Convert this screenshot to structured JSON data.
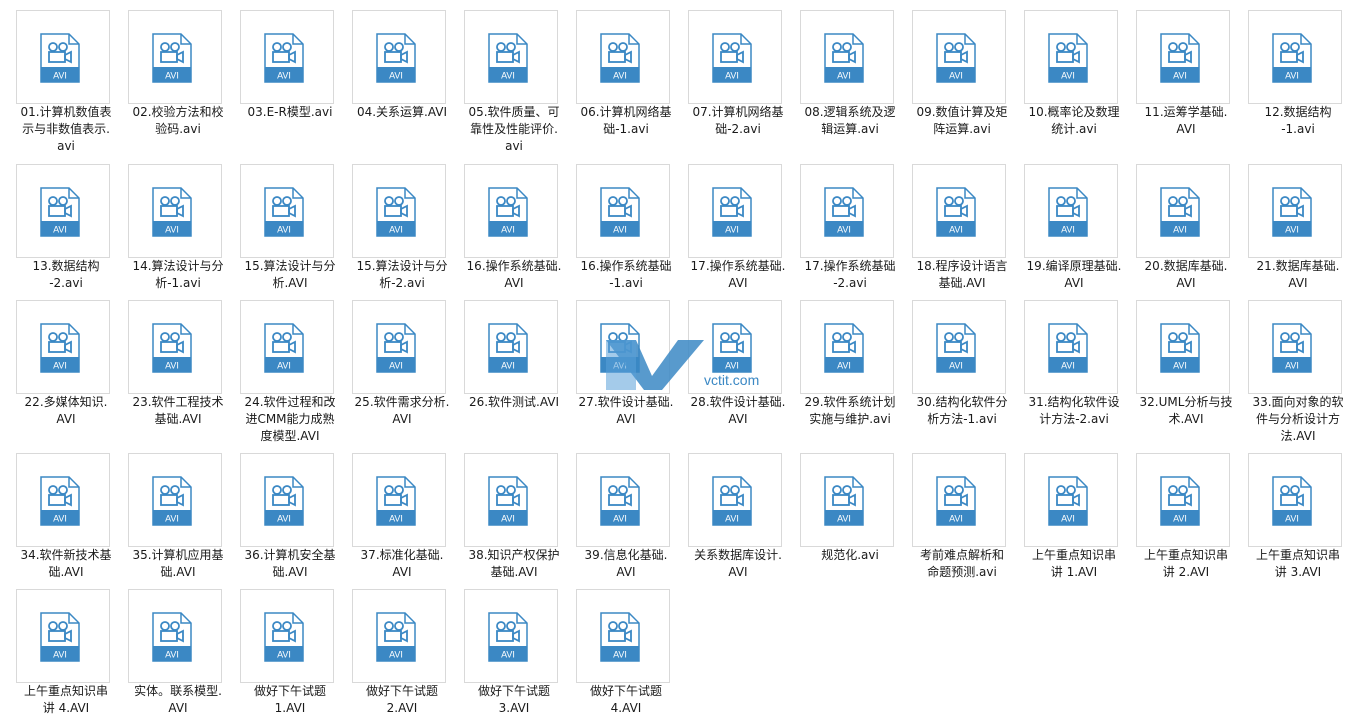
{
  "folder_view": {
    "icon_type_label": "AVI",
    "files": [
      {
        "name": "01.计算机数值表示与非数值表示.avi",
        "lines": [
          "01.计算机数值表",
          "示与非数值表示.",
          "avi"
        ]
      },
      {
        "name": "02.校验方法和校验码.avi",
        "lines": [
          "02.校验方法和校",
          "验码.avi"
        ]
      },
      {
        "name": "03.E-R模型.avi",
        "lines": [
          "03.E-R模型.avi"
        ]
      },
      {
        "name": "04.关系运算.AVI",
        "lines": [
          "04.关系运算.AVI"
        ]
      },
      {
        "name": "05.软件质量、可靠性及性能评价.avi",
        "lines": [
          "05.软件质量、可",
          "靠性及性能评价.",
          "avi"
        ]
      },
      {
        "name": "06.计算机网络基础-1.avi",
        "lines": [
          "06.计算机网络基",
          "础-1.avi"
        ]
      },
      {
        "name": "07.计算机网络基础-2.avi",
        "lines": [
          "07.计算机网络基",
          "础-2.avi"
        ]
      },
      {
        "name": "08.逻辑系统及逻辑运算.avi",
        "lines": [
          "08.逻辑系统及逻",
          "辑运算.avi"
        ]
      },
      {
        "name": "09.数值计算及矩阵运算.avi",
        "lines": [
          "09.数值计算及矩",
          "阵运算.avi"
        ]
      },
      {
        "name": "10.概率论及数理统计.avi",
        "lines": [
          "10.概率论及数理",
          "统计.avi"
        ]
      },
      {
        "name": "11.运筹学基础.AVI",
        "lines": [
          "11.运筹学基础.",
          "AVI"
        ]
      },
      {
        "name": "12.数据结构-1.avi",
        "lines": [
          "12.数据结构",
          "-1.avi"
        ]
      },
      {
        "name": "13.数据结构-2.avi",
        "lines": [
          "13.数据结构",
          "-2.avi"
        ]
      },
      {
        "name": "14.算法设计与分析-1.avi",
        "lines": [
          "14.算法设计与分",
          "析-1.avi"
        ]
      },
      {
        "name": "15.算法设计与分析.AVI",
        "lines": [
          "15.算法设计与分",
          "析.AVI"
        ]
      },
      {
        "name": "15.算法设计与分析-2.avi",
        "lines": [
          "15.算法设计与分",
          "析-2.avi"
        ]
      },
      {
        "name": "16.操作系统基础.AVI",
        "lines": [
          "16.操作系统基础.",
          "AVI"
        ]
      },
      {
        "name": "16.操作系统基础-1.avi",
        "lines": [
          "16.操作系统基础",
          "-1.avi"
        ]
      },
      {
        "name": "17.操作系统基础.AVI",
        "lines": [
          "17.操作系统基础.",
          "AVI"
        ]
      },
      {
        "name": "17.操作系统基础-2.avi",
        "lines": [
          "17.操作系统基础",
          "-2.avi"
        ]
      },
      {
        "name": "18.程序设计语言基础.AVI",
        "lines": [
          "18.程序设计语言",
          "基础.AVI"
        ]
      },
      {
        "name": "19.编译原理基础.AVI",
        "lines": [
          "19.编译原理基础.",
          "AVI"
        ]
      },
      {
        "name": "20.数据库基础.AVI",
        "lines": [
          "20.数据库基础.",
          "AVI"
        ]
      },
      {
        "name": "21.数据库基础.AVI",
        "lines": [
          "21.数据库基础.",
          "AVI"
        ]
      },
      {
        "name": "22.多媒体知识.AVI",
        "lines": [
          "22.多媒体知识.",
          "AVI"
        ]
      },
      {
        "name": "23.软件工程技术基础.AVI",
        "lines": [
          "23.软件工程技术",
          "基础.AVI"
        ]
      },
      {
        "name": "24.软件过程和改进CMM能力成熟度模型.AVI",
        "lines": [
          "24.软件过程和改",
          "进CMM能力成熟",
          "度模型.AVI"
        ]
      },
      {
        "name": "25.软件需求分析.AVI",
        "lines": [
          "25.软件需求分析.",
          "AVI"
        ]
      },
      {
        "name": "26.软件测试.AVI",
        "lines": [
          "26.软件测试.AVI"
        ]
      },
      {
        "name": "27.软件设计基础.AVI",
        "lines": [
          "27.软件设计基础.",
          "AVI"
        ]
      },
      {
        "name": "28.软件设计基础.AVI",
        "lines": [
          "28.软件设计基础.",
          "AVI"
        ]
      },
      {
        "name": "29.软件系统计划实施与维护.avi",
        "lines": [
          "29.软件系统计划",
          "实施与维护.avi"
        ]
      },
      {
        "name": "30.结构化软件分析方法-1.avi",
        "lines": [
          "30.结构化软件分",
          "析方法-1.avi"
        ]
      },
      {
        "name": "31.结构化软件设计方法-2.avi",
        "lines": [
          "31.结构化软件设",
          "计方法-2.avi"
        ]
      },
      {
        "name": "32.UML分析与技术.AVI",
        "lines": [
          "32.UML分析与技",
          "术.AVI"
        ]
      },
      {
        "name": "33.面向对象的软件与分析设计方法.AVI",
        "lines": [
          "33.面向对象的软",
          "件与分析设计方",
          "法.AVI"
        ]
      },
      {
        "name": "34.软件新技术基础.AVI",
        "lines": [
          "34.软件新技术基",
          "础.AVI"
        ]
      },
      {
        "name": "35.计算机应用基础.AVI",
        "lines": [
          "35.计算机应用基",
          "础.AVI"
        ]
      },
      {
        "name": "36.计算机安全基础.AVI",
        "lines": [
          "36.计算机安全基",
          "础.AVI"
        ]
      },
      {
        "name": "37.标准化基础.AVI",
        "lines": [
          "37.标准化基础.",
          "AVI"
        ]
      },
      {
        "name": "38.知识产权保护基础.AVI",
        "lines": [
          "38.知识产权保护",
          "基础.AVI"
        ]
      },
      {
        "name": "39.信息化基础.AVI",
        "lines": [
          "39.信息化基础.",
          "AVI"
        ]
      },
      {
        "name": "关系数据库设计.AVI",
        "lines": [
          "关系数据库设计.",
          "AVI"
        ]
      },
      {
        "name": "规范化.avi",
        "lines": [
          "规范化.avi"
        ]
      },
      {
        "name": "考前难点解析和命题预测.avi",
        "lines": [
          "考前难点解析和",
          "命题预测.avi"
        ]
      },
      {
        "name": "上午重点知识串讲 1.AVI",
        "lines": [
          "上午重点知识串",
          "讲 1.AVI"
        ]
      },
      {
        "name": "上午重点知识串讲 2.AVI",
        "lines": [
          "上午重点知识串",
          "讲 2.AVI"
        ]
      },
      {
        "name": "上午重点知识串讲 3.AVI",
        "lines": [
          "上午重点知识串",
          "讲 3.AVI"
        ]
      },
      {
        "name": "上午重点知识串讲 4.AVI",
        "lines": [
          "上午重点知识串",
          "讲 4.AVI"
        ]
      },
      {
        "name": "实体。联系模型.AVI",
        "lines": [
          "实体。联系模型.",
          "AVI"
        ]
      },
      {
        "name": "做好下午试题1.AVI",
        "lines": [
          "做好下午试题",
          "1.AVI"
        ]
      },
      {
        "name": "做好下午试题2.AVI",
        "lines": [
          "做好下午试题",
          "2.AVI"
        ]
      },
      {
        "name": "做好下午试题3.AVI",
        "lines": [
          "做好下午试题",
          "3.AVI"
        ]
      },
      {
        "name": "做好下午试题4.AVI",
        "lines": [
          "做好下午试题",
          "4.AVI"
        ]
      }
    ]
  },
  "watermark": {
    "text": "vctit.com"
  },
  "colors": {
    "icon_blue": "#3b88c4",
    "thumb_border": "#d9d9d9"
  }
}
